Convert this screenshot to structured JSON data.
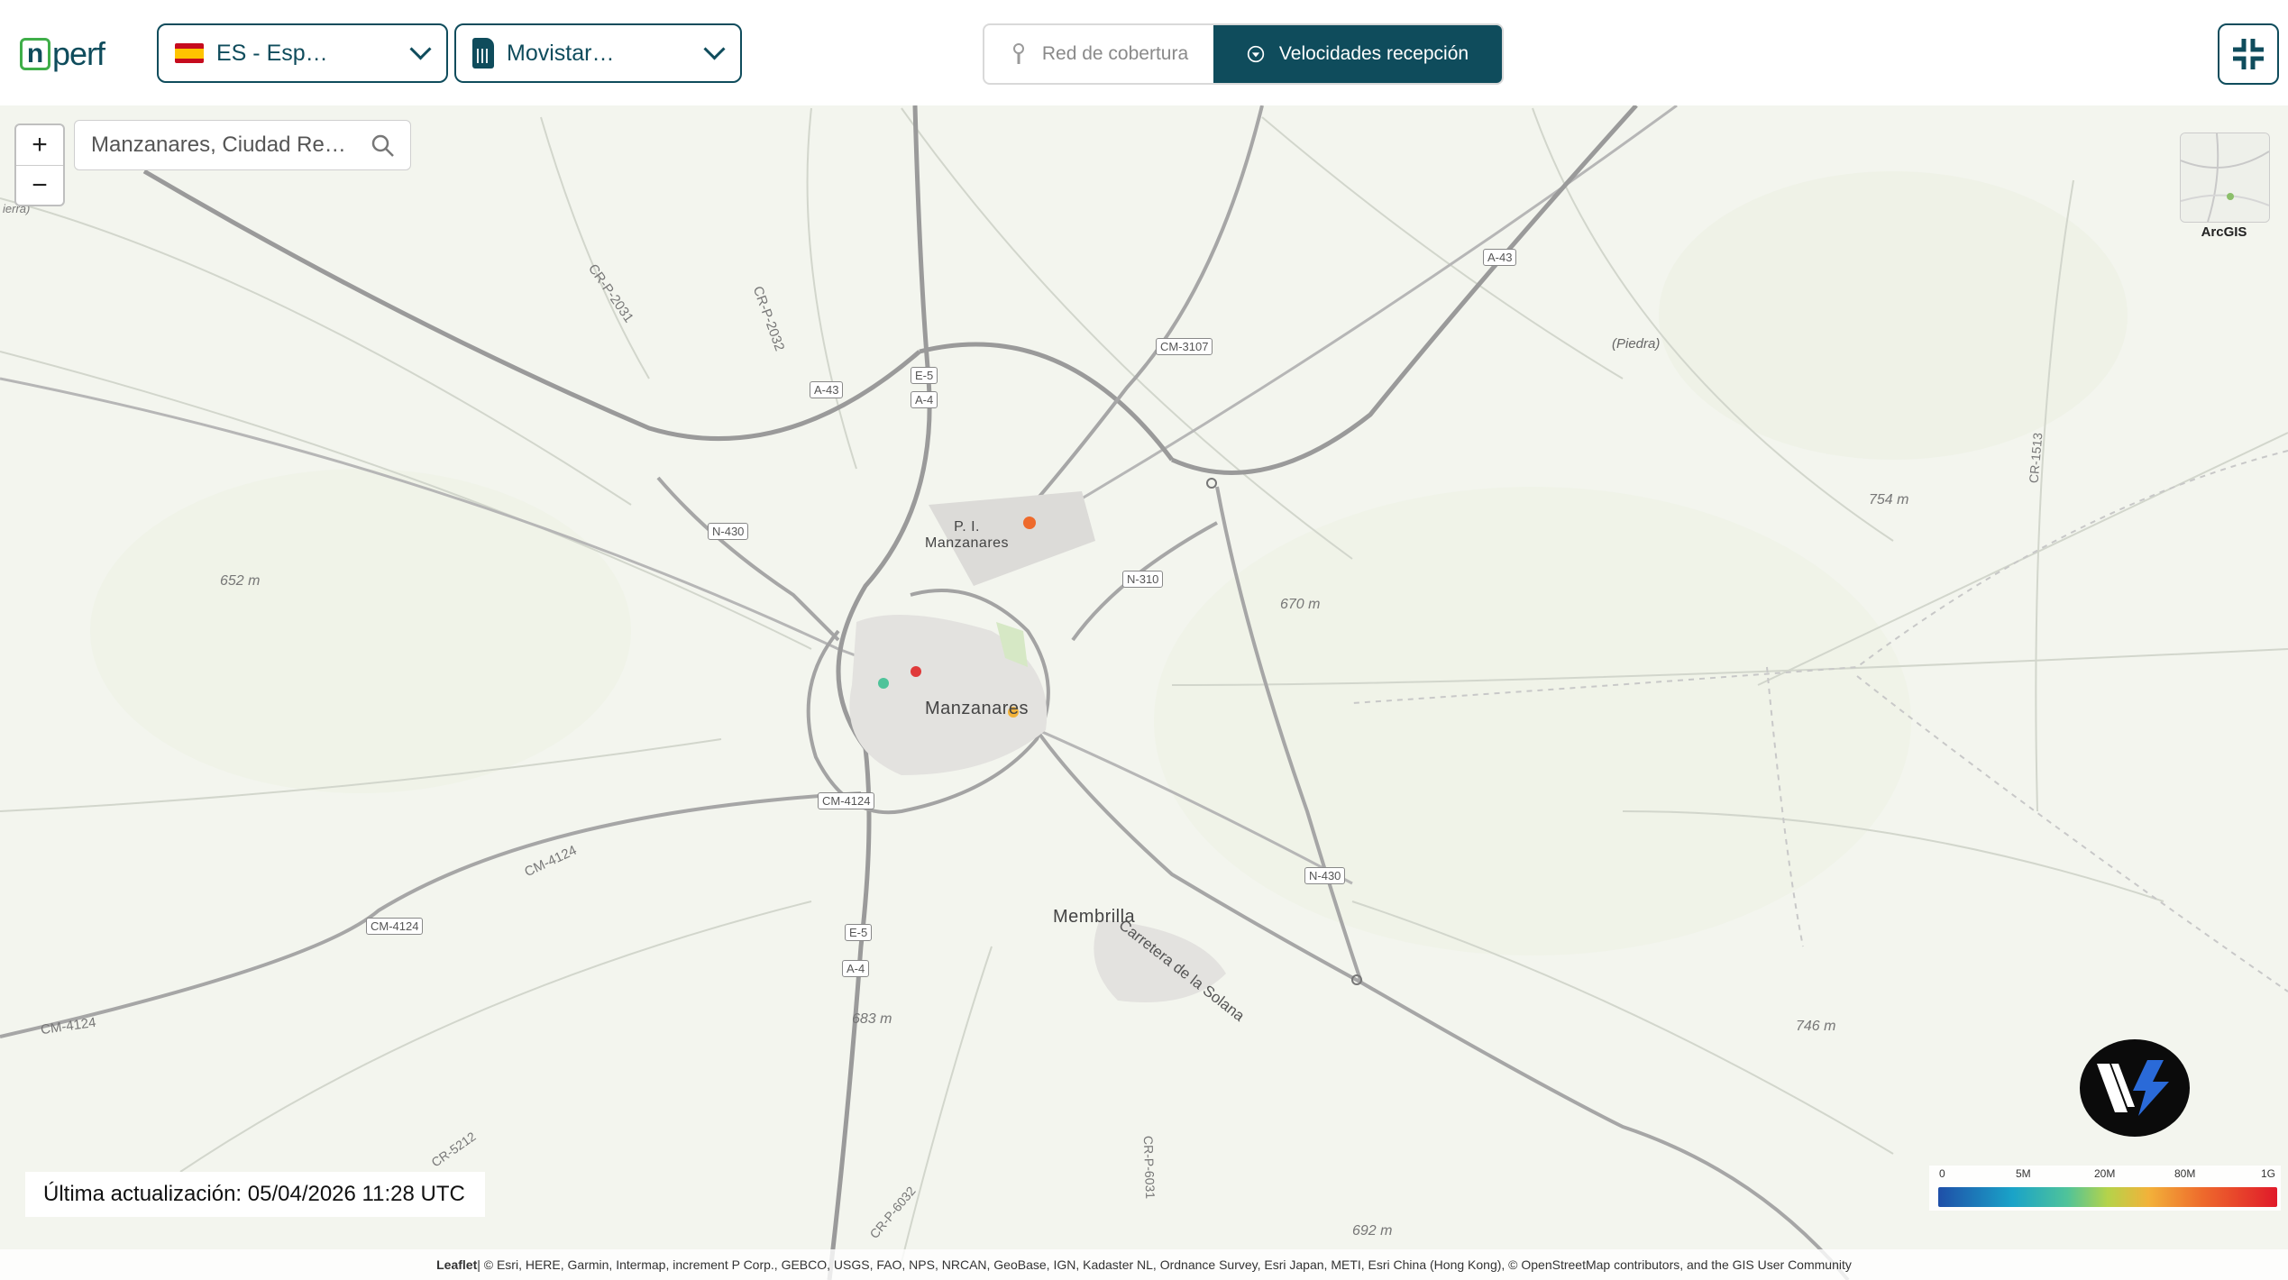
{
  "header": {
    "logo": "nperf",
    "country_select": {
      "value": "ES - Esp…",
      "flag": "spain-flag-icon"
    },
    "operator_select": {
      "value": "Movistar…",
      "icon": "sim-card-icon"
    },
    "tabs": [
      {
        "label": "Red de cobertura",
        "active": false
      },
      {
        "label": "Velocidades recepción",
        "active": true
      }
    ]
  },
  "map": {
    "search": {
      "value": "Manzanares, Ciudad Re…"
    },
    "zoom_in": "+",
    "zoom_out": "−",
    "edge_label": "ierra)",
    "basemap_label": "ArcGIS",
    "towns": {
      "manzanares": "Manzanares",
      "membrilla": "Membrilla",
      "industrial": "P. I.\nManzanares",
      "piedra": "(Piedra)"
    },
    "elevations": [
      "652 m",
      "670 m",
      "754 m",
      "683 m",
      "746 m",
      "692 m"
    ],
    "road_shields": [
      "A-43",
      "E-5",
      "A-4",
      "CM-3107",
      "A-43",
      "N-430",
      "N-310",
      "CM-4124",
      "CM-4124",
      "E-5",
      "A-4",
      "N-430"
    ],
    "road_labels": [
      "CR-P-2031",
      "CR-P-2032",
      "CM-4124",
      "CM-4124",
      "Carretera de la Solana",
      "CR-5212",
      "CR-P-6032",
      "CR-P-6031",
      "CR-1513"
    ]
  },
  "last_update": "Última actualización: 05/04/2026 11:28 UTC",
  "legend": {
    "ticks": [
      "0",
      "5M",
      "20M",
      "80M",
      "1G"
    ]
  },
  "attribution": {
    "leaflet": "Leaflet",
    "text": " | © Esri, HERE, Garmin, Intermap, increment P Corp., GEBCO, USGS, FAO, NPS, NRCAN, GeoBase, IGN, Kadaster NL, Ordnance Survey, Esri Japan, METI, Esri China (Hong Kong), © OpenStreetMap contributors, and the GIS User Community"
  },
  "colors": {
    "brand": "#0f4c5c",
    "logo_green": "#3fae49"
  }
}
